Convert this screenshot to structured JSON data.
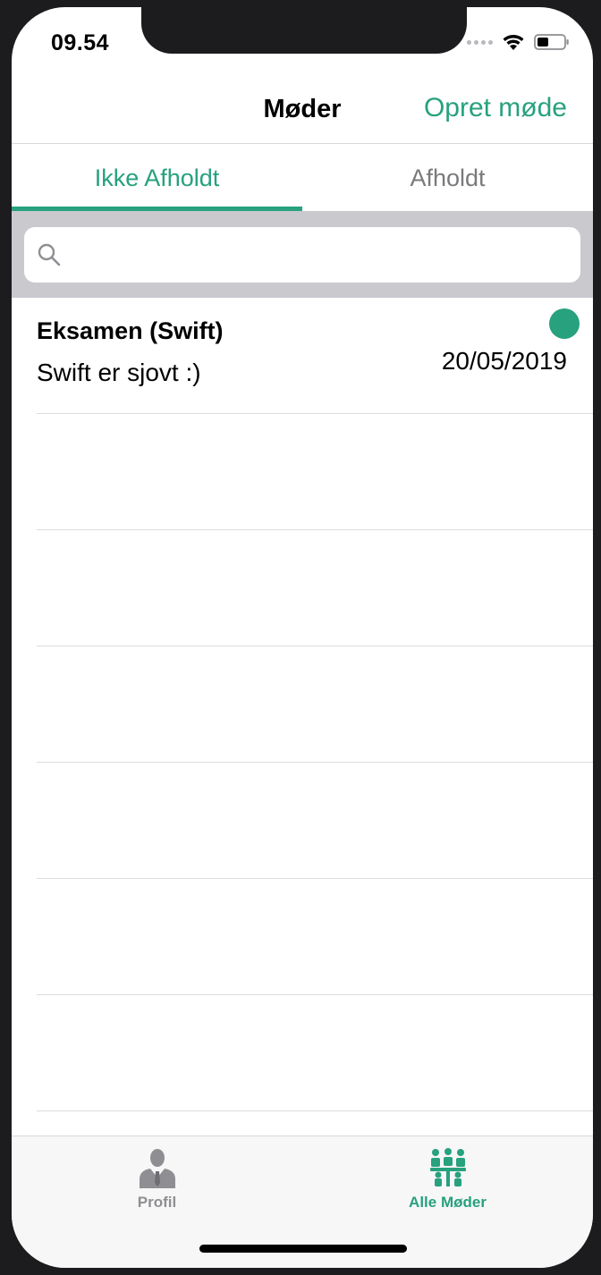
{
  "status_bar": {
    "time": "09.54"
  },
  "nav": {
    "title": "Møder",
    "action": "Opret møde"
  },
  "tabs": {
    "active": "Ikke Afholdt",
    "inactive": "Afholdt"
  },
  "search": {
    "placeholder": "",
    "value": ""
  },
  "meetings": [
    {
      "title": "Eksamen (Swift)",
      "subtitle": "Swift er sjovt :)",
      "date": "20/05/2019",
      "status_color": "#27a17e"
    }
  ],
  "tabbar": {
    "profile_label": "Profil",
    "meetings_label": "Alle Møder",
    "profile_icon": "person-icon",
    "meetings_icon": "meeting-group-icon"
  },
  "colors": {
    "accent": "#27a17e",
    "inactive": "#8e8e93"
  }
}
